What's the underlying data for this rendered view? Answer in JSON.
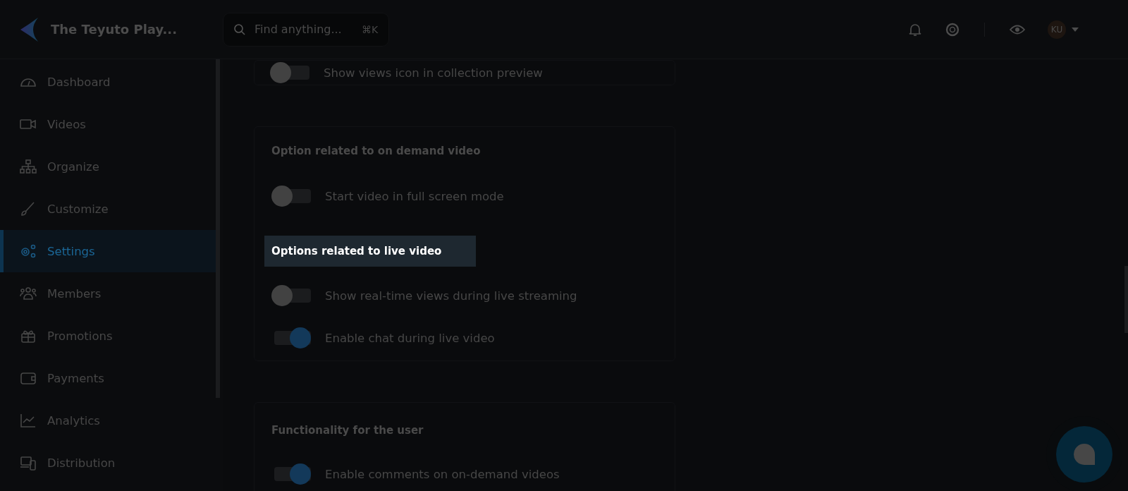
{
  "header": {
    "brand": "The Teyuto Play...",
    "search": {
      "placeholder": "Find anything...",
      "shortcut": "⌘K"
    },
    "avatar": "KU"
  },
  "sidebar": {
    "items": [
      {
        "label": "Dashboard",
        "selected": false
      },
      {
        "label": "Videos",
        "selected": false
      },
      {
        "label": "Organize",
        "selected": false
      },
      {
        "label": "Customize",
        "selected": false
      },
      {
        "label": "Settings",
        "selected": true
      },
      {
        "label": "Members",
        "selected": false
      },
      {
        "label": "Promotions",
        "selected": false
      },
      {
        "label": "Payments",
        "selected": false
      },
      {
        "label": "Analytics",
        "selected": false
      },
      {
        "label": "Distribution",
        "selected": false
      }
    ]
  },
  "sections": [
    {
      "items": [
        {
          "kind": "toggle",
          "label": "Show views icon in collection preview",
          "on": false
        }
      ]
    },
    {
      "items": [
        {
          "kind": "heading",
          "label": "Option related to on demand video",
          "highlighted": false
        },
        {
          "kind": "toggle",
          "label": "Start video in full screen mode",
          "on": false
        },
        {
          "kind": "heading",
          "label": "Options related to live video",
          "highlighted": true
        },
        {
          "kind": "toggle",
          "label": "Show real-time views during live streaming",
          "on": false
        },
        {
          "kind": "toggle",
          "label": "Enable chat during live video",
          "on": true
        }
      ]
    },
    {
      "items": [
        {
          "kind": "heading",
          "label": "Functionality for the user",
          "highlighted": false
        },
        {
          "kind": "toggle",
          "label": "Enable comments on on-demand videos",
          "on": true
        }
      ]
    }
  ]
}
